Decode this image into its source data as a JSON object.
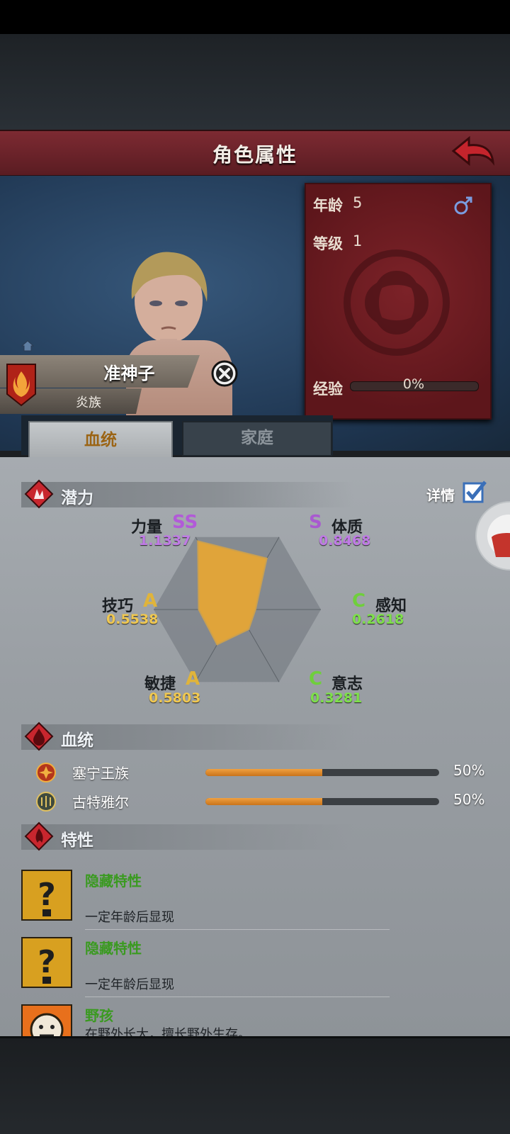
{
  "header": {
    "title": "角色属性"
  },
  "character": {
    "name": "准神子",
    "clan": "炎族",
    "stats": {
      "age_label": "年龄",
      "age": "5",
      "level_label": "等级",
      "level": "1",
      "exp_label": "经验",
      "exp": "0%",
      "exp_fraction": 0
    }
  },
  "tabs": [
    {
      "label": "血统",
      "active": true
    },
    {
      "label": "家庭",
      "active": false
    }
  ],
  "potential": {
    "title": "潜力",
    "detail_label": "详情",
    "detail_checked": true,
    "attributes": [
      {
        "name": "力量",
        "grade": "SS",
        "value": "1.1337",
        "grade_color": "#b25ad8",
        "value_color": "#c07ae6"
      },
      {
        "name": "体质",
        "grade": "S",
        "value": "0.8468",
        "grade_color": "#a95ad0",
        "value_color": "#c07ae6"
      },
      {
        "name": "感知",
        "grade": "C",
        "value": "0.2618",
        "grade_color": "#6fcf3c",
        "value_color": "#7ee04a"
      },
      {
        "name": "意志",
        "grade": "C",
        "value": "0.3281",
        "grade_color": "#6fcf3c",
        "value_color": "#7ee04a"
      },
      {
        "name": "敏捷",
        "grade": "A",
        "value": "0.5803",
        "grade_color": "#e0b43a",
        "value_color": "#f0c850"
      },
      {
        "name": "技巧",
        "grade": "A",
        "value": "0.5538",
        "grade_color": "#e0b43a",
        "value_color": "#f0c850"
      }
    ]
  },
  "lineage": {
    "title": "血统",
    "items": [
      {
        "name": "塞宁王族",
        "percent": "50%",
        "fraction": 0.5
      },
      {
        "name": "古特雅尔",
        "percent": "50%",
        "fraction": 0.5
      }
    ]
  },
  "traits": {
    "title": "特性",
    "items": [
      {
        "name": "隐藏特性",
        "desc": "一定年龄后显现",
        "icon": "question-icon"
      },
      {
        "name": "隐藏特性",
        "desc": "一定年龄后显现",
        "icon": "question-icon"
      },
      {
        "name": "野孩",
        "desc": "在野外长大，擅长野外生存。",
        "icon": "wild-child-icon"
      }
    ]
  },
  "colors": {
    "accent_red": "#6e2228",
    "tab_gold": "#9b6414",
    "radar_fill": "#e0a43a",
    "trait_green": "#3a9a20"
  }
}
